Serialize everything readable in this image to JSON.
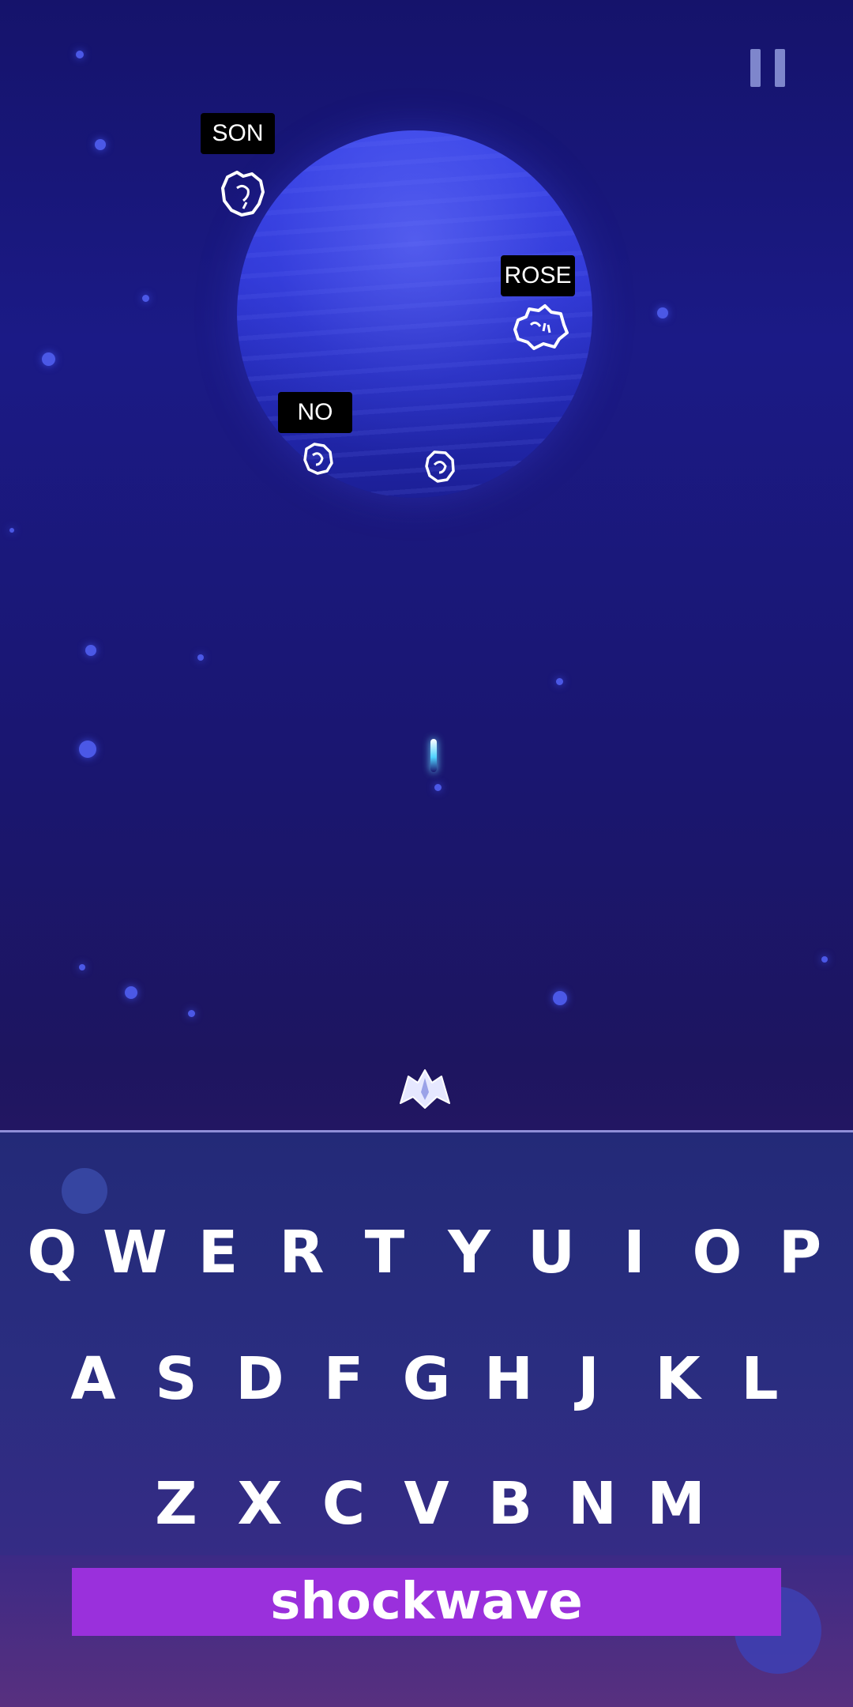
{
  "game": {
    "targets": [
      {
        "word": "SON"
      },
      {
        "word": "ROSE"
      },
      {
        "word": "NO"
      }
    ],
    "typed_word": "shockwave"
  },
  "keyboard": {
    "row1": [
      "Q",
      "W",
      "E",
      "R",
      "T",
      "Y",
      "U",
      "I",
      "O",
      "P"
    ],
    "row2": [
      "A",
      "S",
      "D",
      "F",
      "G",
      "H",
      "J",
      "K",
      "L"
    ],
    "row3": [
      "Z",
      "X",
      "C",
      "V",
      "B",
      "N",
      "M"
    ]
  },
  "icons": {
    "pause": "pause-icon",
    "ship": "spaceship-icon",
    "asteroid": "asteroid-icon"
  },
  "colors": {
    "background": "#1b1a86",
    "planet": "#2f37d4",
    "word_bar": "#9a30dc",
    "laser": "#4fd3ff"
  }
}
